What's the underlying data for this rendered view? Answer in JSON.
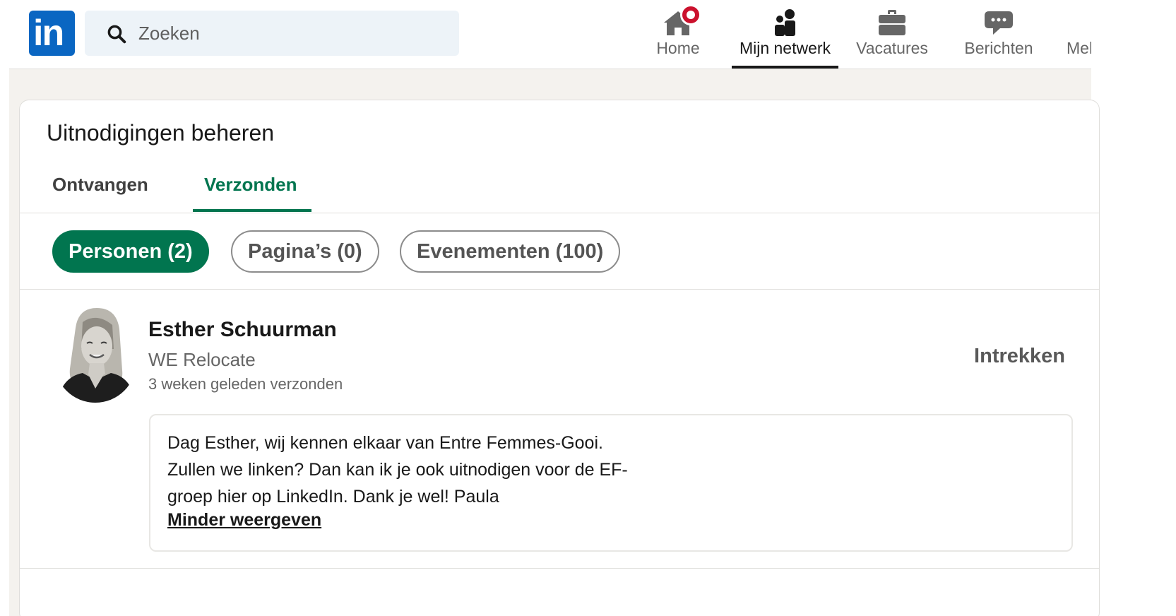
{
  "header": {
    "logo_text": "in",
    "search": {
      "placeholder": "Zoeken"
    },
    "nav": [
      {
        "label": "Home",
        "icon": "home-icon",
        "badge": true,
        "active": false
      },
      {
        "label": "Mijn netwerk",
        "icon": "people-icon",
        "active": true
      },
      {
        "label": "Vacatures",
        "icon": "briefcase-icon",
        "active": false
      },
      {
        "label": "Berichten",
        "icon": "message-icon",
        "active": false
      },
      {
        "label": "Mel",
        "icon": "bell-icon",
        "active": false
      }
    ],
    "colors": {
      "brand": "#0a66c2",
      "badge": "#cb112d"
    }
  },
  "invitations": {
    "title": "Uitnodigingen beheren",
    "tabs": [
      {
        "label": "Ontvangen",
        "active": false
      },
      {
        "label": "Verzonden",
        "active": true
      }
    ],
    "filters": [
      {
        "label": "Personen (2)",
        "active": true
      },
      {
        "label": "Pagina’s (0)",
        "active": false
      },
      {
        "label": "Evenementen (100)",
        "active": false
      }
    ],
    "accent_color": "#01754f",
    "items": [
      {
        "name": "Esther Schuurman",
        "company": "WE Relocate",
        "sent": "3 weken geleden verzonden",
        "action": "Intrekken",
        "message": "Dag Esther, wij kennen elkaar van Entre Femmes-Gooi. Zullen we linken? Dan kan ik je ook uitnodigen voor de EF-groep hier op LinkedIn. Dank je wel! Paula",
        "toggle_label": "Minder weergeven"
      }
    ]
  }
}
